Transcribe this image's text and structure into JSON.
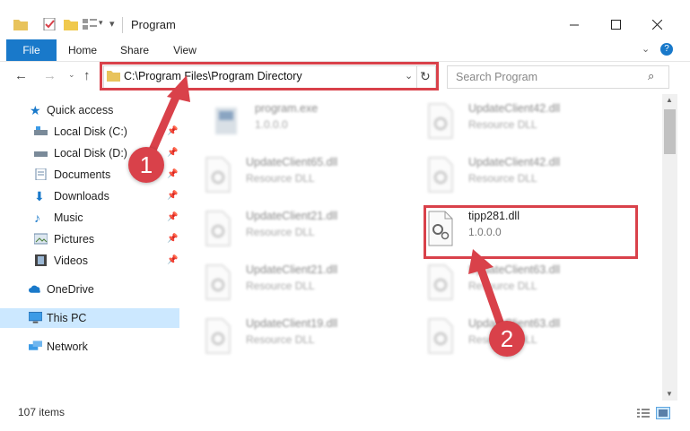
{
  "window": {
    "title": "Program"
  },
  "ribbon": {
    "tabs": [
      {
        "label": "File"
      },
      {
        "label": "Home"
      },
      {
        "label": "Share"
      },
      {
        "label": "View"
      }
    ]
  },
  "address": {
    "path": "C:\\Program Files\\Program Directory"
  },
  "search": {
    "placeholder": "Search Program"
  },
  "nav": {
    "items": [
      {
        "label": "Quick access"
      },
      {
        "label": "Local Disk (C:)"
      },
      {
        "label": "Local Disk (D:)"
      },
      {
        "label": "Documents"
      },
      {
        "label": "Downloads"
      },
      {
        "label": "Music"
      },
      {
        "label": "Pictures"
      },
      {
        "label": "Videos"
      },
      {
        "label": "OneDrive"
      },
      {
        "label": "This PC"
      },
      {
        "label": "Network"
      }
    ]
  },
  "files": [
    {
      "name": "program.exe",
      "sub": "1.0.0.0"
    },
    {
      "name": "UpdateClient42.dll",
      "sub": "Resource DLL"
    },
    {
      "name": "UpdateClient65.dll",
      "sub": "Resource DLL"
    },
    {
      "name": "UpdateClient42.dll",
      "sub": "Resource DLL"
    },
    {
      "name": "UpdateClient21.dll",
      "sub": "Resource DLL"
    },
    {
      "name": "tipp281.dll",
      "sub": "1.0.0.0"
    },
    {
      "name": "UpdateClient21.dll",
      "sub": "Resource DLL"
    },
    {
      "name": "UpdateClient63.dll",
      "sub": "Resource DLL"
    },
    {
      "name": "UpdateClient19.dll",
      "sub": "Resource DLL"
    },
    {
      "name": "UpdateClient63.dll",
      "sub": "Resource DLL"
    }
  ],
  "status": {
    "item_count": "107 items"
  },
  "callouts": {
    "one": "1",
    "two": "2"
  },
  "colors": {
    "accent": "#1979ca",
    "highlight": "#d9414a",
    "selected": "#cce8ff"
  }
}
